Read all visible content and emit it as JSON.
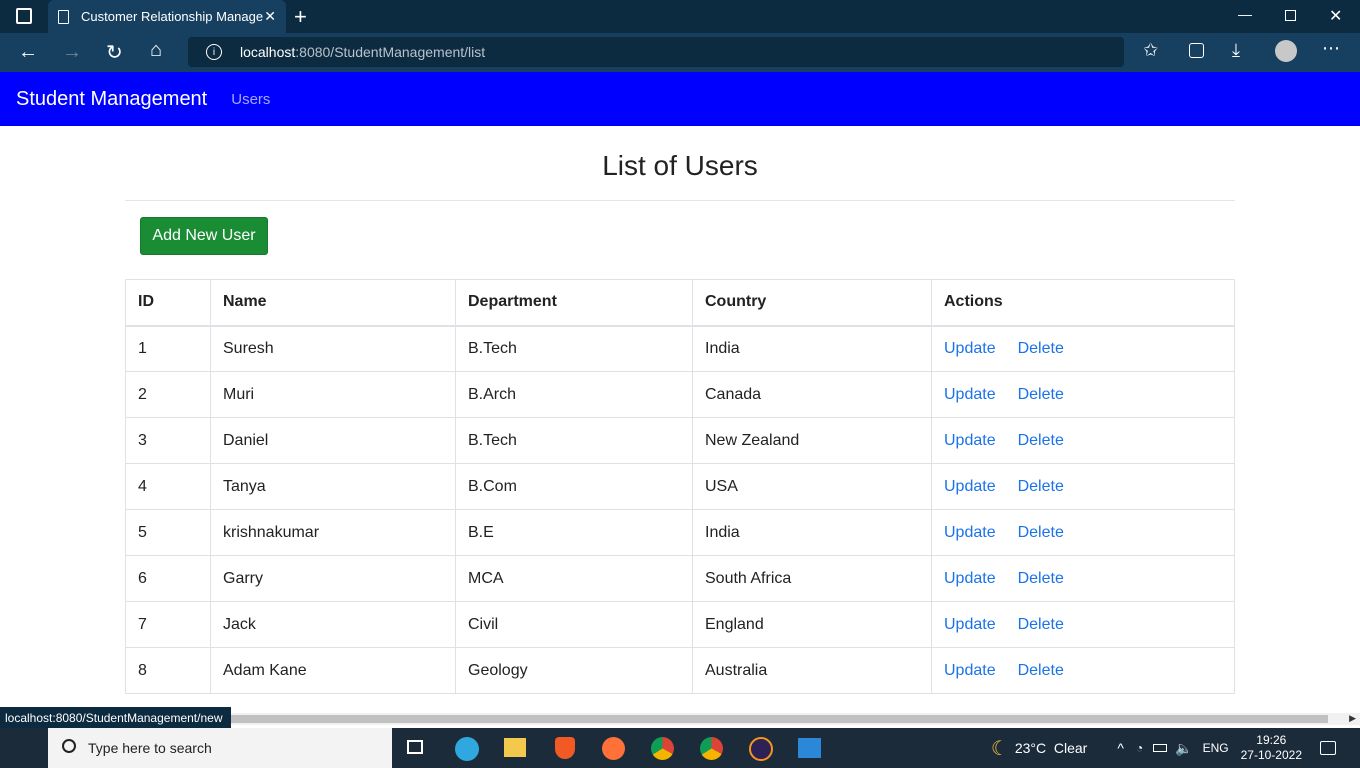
{
  "browser": {
    "tab_title": "Customer Relationship Managem",
    "url_host": "localhost",
    "url_path": ":8080/StudentManagement/list"
  },
  "nav": {
    "brand": "Student Management",
    "link": "Users"
  },
  "page": {
    "title": "List of Users",
    "add_button": "Add New User"
  },
  "table": {
    "headers": [
      "ID",
      "Name",
      "Department",
      "Country",
      "Actions"
    ],
    "rows": [
      [
        "1",
        "Suresh",
        "B.Tech",
        "India"
      ],
      [
        "2",
        "Muri",
        "B.Arch",
        "Canada"
      ],
      [
        "3",
        "Daniel",
        "B.Tech",
        "New Zealand"
      ],
      [
        "4",
        "Tanya",
        "B.Com",
        "USA"
      ],
      [
        "5",
        "krishnakumar",
        "B.E",
        "India"
      ],
      [
        "6",
        "Garry",
        "MCA",
        "South Africa"
      ],
      [
        "7",
        "Jack",
        "Civil",
        "England"
      ],
      [
        "8",
        "Adam Kane",
        "Geology",
        "Australia"
      ]
    ],
    "update_label": "Update",
    "delete_label": "Delete"
  },
  "status_bar": {
    "url": "localhost:8080/StudentManagement/new"
  },
  "taskbar": {
    "search_placeholder": "Type here to search",
    "weather": "23°C  Clear",
    "lang": "ENG",
    "time": "19:26",
    "date": "27-10-2022"
  }
}
